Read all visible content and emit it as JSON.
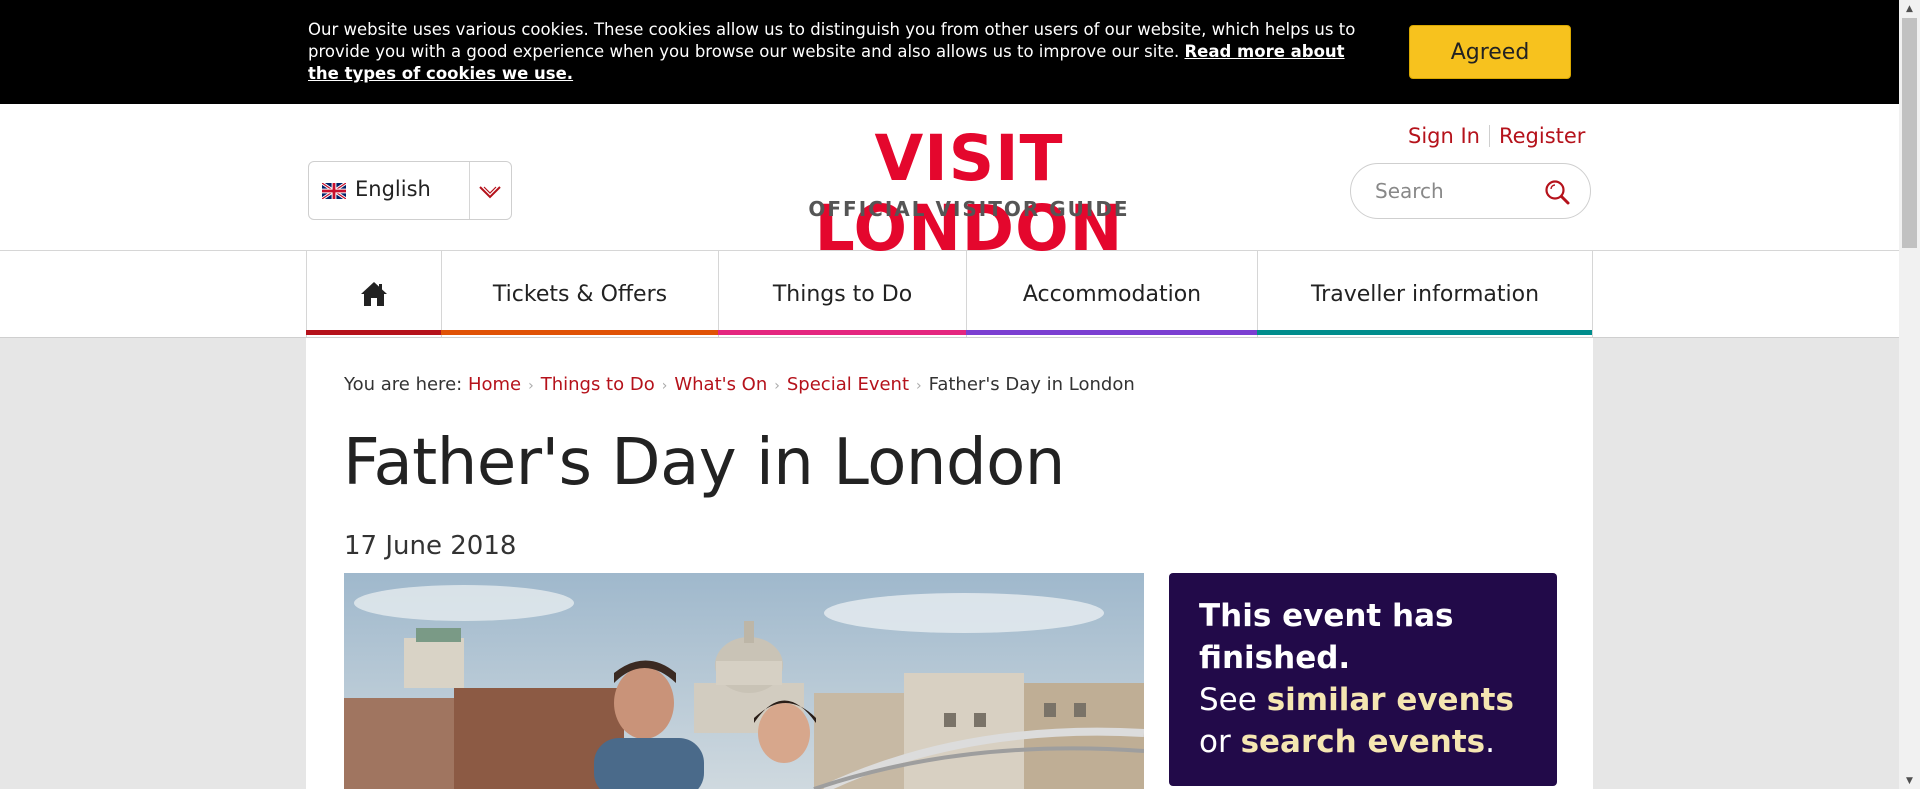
{
  "cookie_bar": {
    "text": "Our website uses various cookies. These cookies allow us to distinguish you from other users of our website, which helps us to provide you with a good experience when you browse our website and also allows us to improve our site. ",
    "link": "Read more about the types of cookies we use.",
    "button": "Agreed"
  },
  "header": {
    "language": "English",
    "logo_title": "VISIT LONDON",
    "logo_subtitle": "OFFICIAL VISITOR GUIDE",
    "sign_in": "Sign In",
    "register": "Register",
    "search_placeholder": "Search",
    "search_value": ""
  },
  "nav": {
    "home_icon": "home-icon",
    "items": [
      {
        "label": "Tickets & Offers",
        "color": "#e05206"
      },
      {
        "label": "Things to Do",
        "color": "#e4267f"
      },
      {
        "label": "Accommodation",
        "color": "#7b3fd1"
      },
      {
        "label": "Traveller information",
        "color": "#008d8c"
      }
    ],
    "home_color": "#b5121b"
  },
  "breadcrumb": {
    "prefix": "You are here:",
    "items": [
      "Home",
      "Things to Do",
      "What's On",
      "Special Event"
    ],
    "current": "Father's Day in London"
  },
  "page": {
    "title": "Father's Day in London",
    "date": "17 June 2018"
  },
  "status_box": {
    "title": "This event has finished.",
    "see": "See",
    "link1": "similar events",
    "or": "or",
    "link2": "search events",
    "end": "."
  },
  "colors": {
    "brand_red": "#e4072d",
    "link_red": "#b5121b",
    "status_bg": "#220a49",
    "agreed_button": "#f7c21e"
  }
}
